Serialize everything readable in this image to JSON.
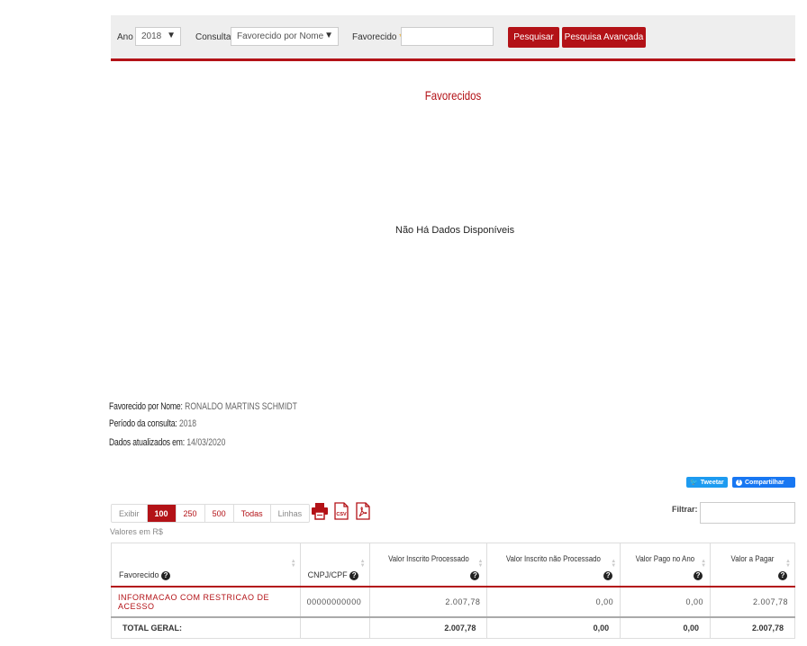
{
  "filters": {
    "ano_label": "Ano",
    "ano_value": "2018",
    "consulta_label": "Consulta",
    "consulta_value": "Favorecido por Nome",
    "favorecido_label": "Favorecido",
    "required_mark": "*",
    "favorecido_value": "",
    "pesquisar_label": "Pesquisar",
    "pesquisa_avancada_label": "Pesquisa Avançada"
  },
  "section_title": "Favorecidos",
  "empty_message": "Não Há Dados Disponíveis",
  "info": {
    "favorecido_label": "Favorecido por Nome:",
    "favorecido_value": "RONALDO MARTINS SCHMIDT",
    "periodo_label": "Período da consulta:",
    "periodo_value": "2018",
    "atualizados_label": "Dados atualizados em:",
    "atualizados_value": "14/03/2020"
  },
  "share": {
    "tweet_label": "Tweetar",
    "share_label": "Compartilhar"
  },
  "paging": {
    "exibir_label": "Exibir",
    "options": [
      "100",
      "250",
      "500",
      "Todas"
    ],
    "selected": "100",
    "linhas_label": "Linhas"
  },
  "export": {
    "icons": [
      "print-icon",
      "csv-icon",
      "pdf-icon"
    ],
    "csv_text": "CSV"
  },
  "valores_label": "Valores em R$",
  "filtrar_label": "Filtrar:",
  "table": {
    "headers": [
      "Favorecido",
      "CNPJ/CPF",
      "Valor Inscrito Processado",
      "Valor Inscrito não Processado",
      "Valor Pago no Ano",
      "Valor a Pagar"
    ],
    "rows": [
      [
        "INFORMACAO COM RESTRICAO DE ACESSO",
        "00000000000",
        "2.007,78",
        "0,00",
        "0,00",
        "2.007,78"
      ]
    ],
    "footer": [
      "TOTAL GERAL:",
      "",
      "2.007,78",
      "0,00",
      "0,00",
      "2.007,78"
    ]
  },
  "colors": {
    "accent": "#b31217",
    "bar_bg": "#eeeeee"
  }
}
